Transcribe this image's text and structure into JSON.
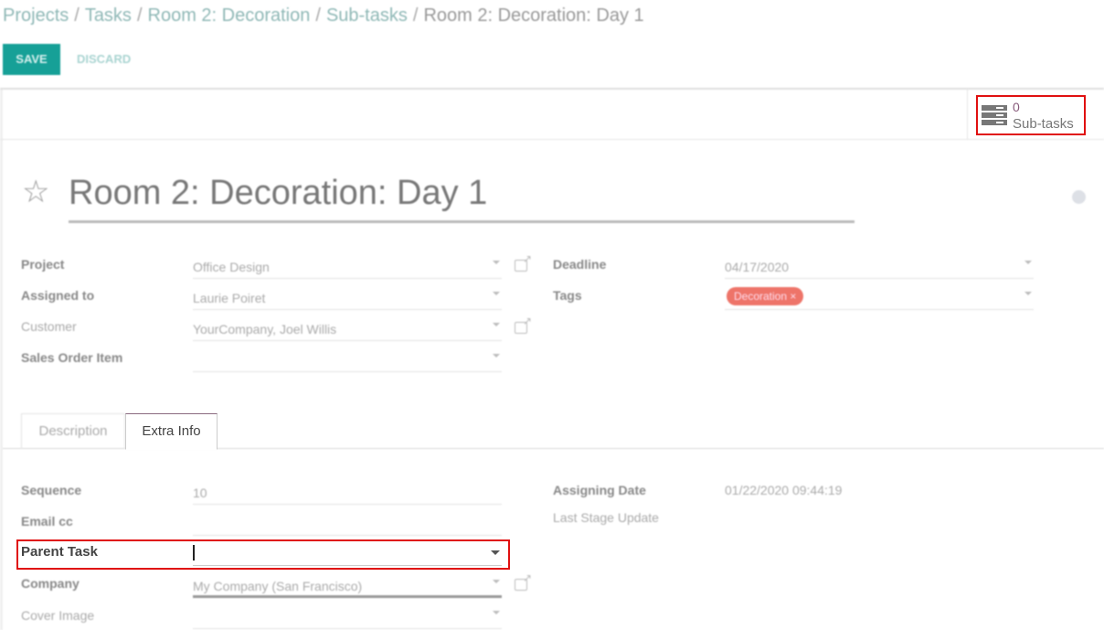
{
  "breadcrumb": {
    "items": [
      "Projects",
      "Tasks",
      "Room 2: Decoration",
      "Sub-tasks"
    ],
    "current": "Room 2: Decoration: Day 1",
    "separator": "/"
  },
  "toolbar": {
    "save_label": "SAVE",
    "discard_label": "DISCARD"
  },
  "smart_button": {
    "count": "0",
    "label": "Sub-tasks",
    "icon": "tasks-icon"
  },
  "record": {
    "title": "Room 2: Decoration: Day 1",
    "favorite_icon": "star-icon"
  },
  "fields_left": [
    {
      "label": "Project",
      "value": "Office Design",
      "external_link": true
    },
    {
      "label": "Assigned to",
      "value": "Laurie Poiret",
      "external_link": false
    },
    {
      "label": "Customer",
      "value": "YourCompany, Joel Willis",
      "external_link": true
    },
    {
      "label": "Sales Order Item",
      "value": "",
      "external_link": false
    }
  ],
  "fields_right": [
    {
      "label": "Deadline",
      "value": "04/17/2020"
    },
    {
      "label": "Tags",
      "value": ""
    }
  ],
  "tags": [
    {
      "label": "Decoration",
      "remove": "×",
      "color": "#ee7469"
    }
  ],
  "tabs": [
    {
      "label": "Description",
      "active": false
    },
    {
      "label": "Extra Info",
      "active": true
    }
  ],
  "extra_left": [
    {
      "label": "Sequence",
      "value": "10"
    },
    {
      "label": "Email cc",
      "value": ""
    },
    {
      "label": "Parent Task",
      "value": ""
    },
    {
      "label": "Company",
      "value": "My Company (San Francisco)"
    },
    {
      "label": "Cover Image",
      "value": ""
    }
  ],
  "extra_right": [
    {
      "label": "Assigning Date",
      "value": "01/22/2020 09:44:19"
    },
    {
      "label": "Last Stage Update",
      "value": ""
    }
  ]
}
